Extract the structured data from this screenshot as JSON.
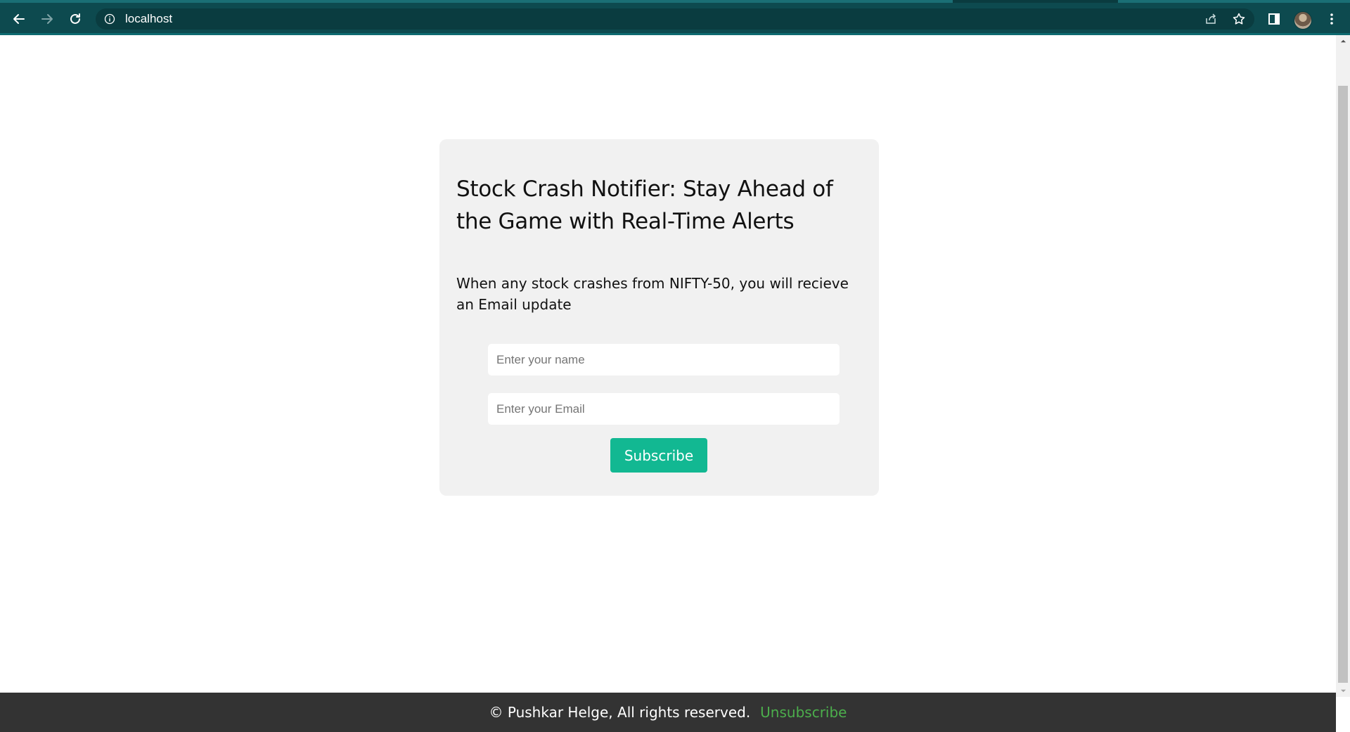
{
  "browser": {
    "url": "localhost",
    "icons": {
      "back": "arrow-left-icon",
      "forward": "arrow-right-icon",
      "reload": "reload-icon",
      "site_info": "info-icon",
      "share": "share-icon",
      "bookmark": "star-icon",
      "side_panel": "side-panel-icon",
      "profile": "avatar",
      "menu": "kebab-menu-icon"
    },
    "colors": {
      "toolbar": "#0d4a4f",
      "omnibox": "#0a3c40"
    }
  },
  "main": {
    "title": "Stock Crash Notifier: Stay Ahead of the Game with Real-Time Alerts",
    "description": "When any stock crashes from NIFTY-50, you will recieve an Email update",
    "form": {
      "name_placeholder": "Enter your name",
      "email_placeholder": "Enter your Email",
      "submit_label": "Subscribe"
    },
    "colors": {
      "card_background": "#f1f1f1",
      "button": "#12b892"
    }
  },
  "footer": {
    "copyright": "© Pushkar Helge, All rights reserved.",
    "unsubscribe_label": "Unsubscribe",
    "colors": {
      "background": "#333333",
      "link": "#4cae4c"
    }
  }
}
